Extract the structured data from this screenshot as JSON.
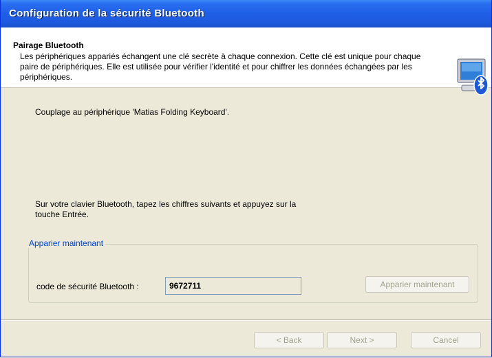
{
  "window": {
    "title": "Configuration de la sécurité Bluetooth"
  },
  "header": {
    "title": "Pairage Bluetooth",
    "description": "Les périphériques appariés échangent une clé secrète à chaque connexion. Cette clé est unique pour chaque paire de périphériques. Elle est utilisée pour vérifier l'identité et pour chiffrer les données échangées par les périphériques.",
    "icon": "bluetooth-computer-icon"
  },
  "main": {
    "coupling_text": "Couplage au périphérique 'Matias Folding Keyboard'.",
    "instruction_line1": "Sur votre clavier Bluetooth, tapez les chiffres suivants et appuyez sur la",
    "instruction_line2": "touche Entrée."
  },
  "group": {
    "legend": "Apparier maintenant",
    "code_label": "code de sécurité Bluetooth :",
    "code_value": "9672711",
    "pair_button": "Apparier maintenant"
  },
  "footer": {
    "back": "< Back",
    "next": "Next >",
    "cancel": "Cancel"
  },
  "colors": {
    "titlebar": "#1e5ee6",
    "dialog_bg": "#ece9d8",
    "legend": "#0046d5"
  }
}
